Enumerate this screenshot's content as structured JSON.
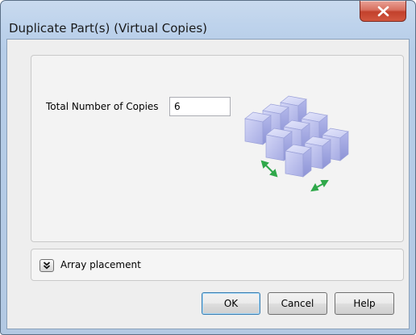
{
  "window": {
    "title": "Duplicate Part(s) (Virtual Copies)",
    "close_icon": "close-icon"
  },
  "copies": {
    "label": "Total Number of Copies",
    "value": "6"
  },
  "illustration": {
    "icon": "array-cubes-illustration",
    "arrow_color": "#2fa84a",
    "cube_color": "#c9cdf3"
  },
  "array_placement": {
    "label": "Array placement",
    "expand_icon": "double-chevron-down-icon"
  },
  "buttons": {
    "ok": "OK",
    "cancel": "Cancel",
    "help": "Help"
  }
}
